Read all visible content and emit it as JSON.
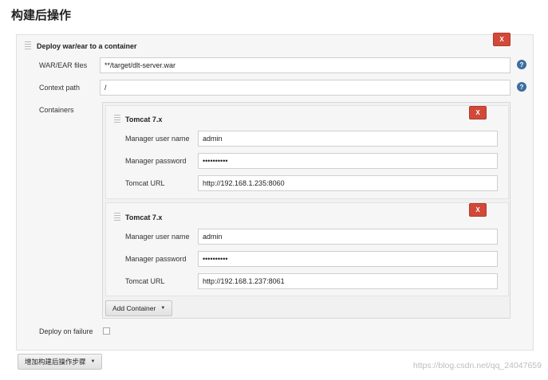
{
  "page": {
    "title": "构建后操作"
  },
  "deploy": {
    "title": "Deploy war/ear to a container",
    "close_label": "X",
    "war_label": "WAR/EAR files",
    "war_value": "**/target/dlt-server.war",
    "context_label": "Context path",
    "context_value": "/",
    "containers_label": "Containers",
    "help_symbol": "?",
    "containers": [
      {
        "title": "Tomcat 7.x",
        "close_label": "X",
        "user_label": "Manager user name",
        "user_value": "admin",
        "password_label": "Manager password",
        "password_value": "••••••••••",
        "url_label": "Tomcat URL",
        "url_value": "http://192.168.1.235:8060"
      },
      {
        "title": "Tomcat 7.x",
        "close_label": "X",
        "user_label": "Manager user name",
        "user_value": "admin",
        "password_label": "Manager password",
        "password_value": "••••••••••",
        "url_label": "Tomcat URL",
        "url_value": "http://192.168.1.237:8061"
      }
    ],
    "add_container_label": "Add Container",
    "deploy_on_failure_label": "Deploy on failure"
  },
  "add_step_label": "增加构建后操作步骤",
  "watermark": "https://blog.csdn.net/qq_24047659"
}
